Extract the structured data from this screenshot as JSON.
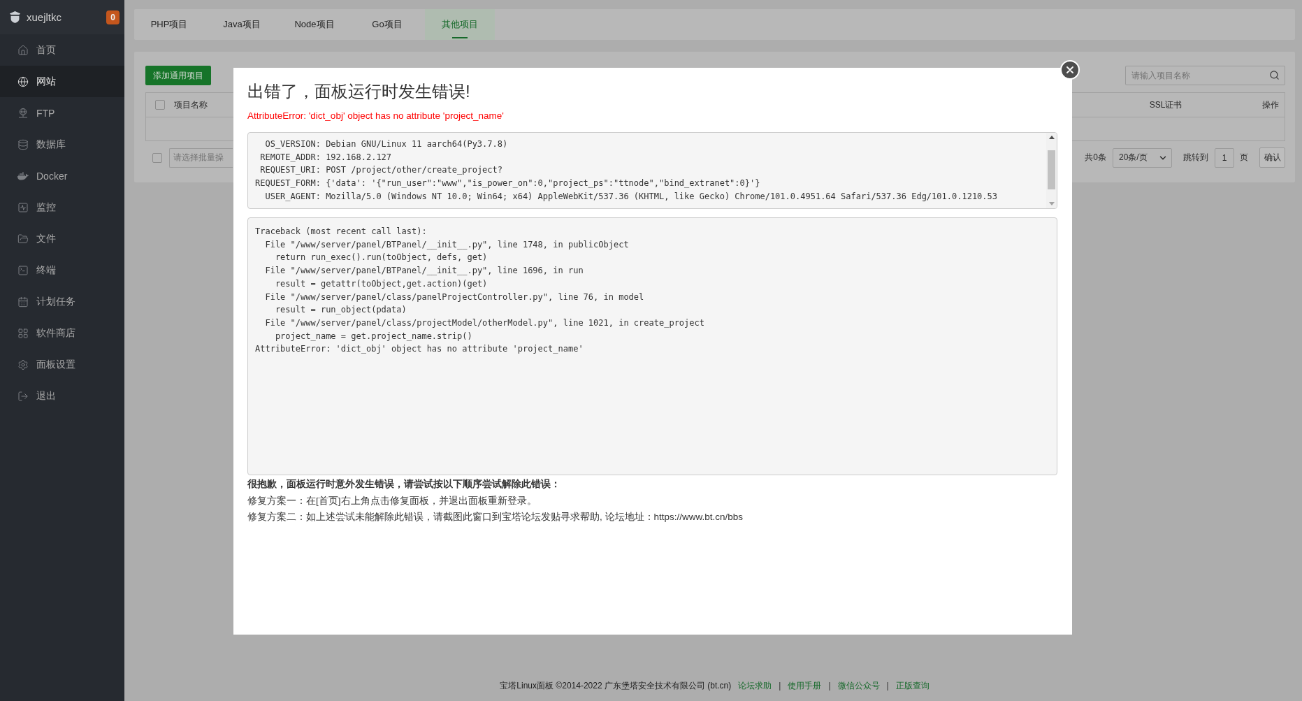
{
  "sidebar": {
    "user": "xuejltkc",
    "badge": "0",
    "items": [
      {
        "label": "首页",
        "selected": false
      },
      {
        "label": "网站",
        "selected": true
      },
      {
        "label": "FTP",
        "selected": false
      },
      {
        "label": "数据库",
        "selected": false
      },
      {
        "label": "Docker",
        "selected": false
      },
      {
        "label": "监控",
        "selected": false
      },
      {
        "label": "文件",
        "selected": false
      },
      {
        "label": "终端",
        "selected": false
      },
      {
        "label": "计划任务",
        "selected": false
      },
      {
        "label": "软件商店",
        "selected": false
      },
      {
        "label": "面板设置",
        "selected": false
      },
      {
        "label": "退出",
        "selected": false
      }
    ]
  },
  "tabs": [
    {
      "label": "PHP项目",
      "selected": false
    },
    {
      "label": "Java项目",
      "selected": false
    },
    {
      "label": "Node项目",
      "selected": false
    },
    {
      "label": "Go项目",
      "selected": false
    },
    {
      "label": "其他项目",
      "selected": true
    }
  ],
  "toolbar": {
    "add_button": "添加通用项目",
    "search": {
      "placeholder": "请输入项目名称"
    }
  },
  "table": {
    "select_all": {
      "checked": false
    },
    "columns": [
      "项目名称",
      "SSL证书",
      "操作"
    ]
  },
  "batch": {
    "checked": false,
    "placeholder": "请选择批量操"
  },
  "pagination": {
    "total": "共0条",
    "page_size": "20条/页",
    "jump_label": "跳转到",
    "page": "1",
    "page_unit": "页",
    "confirm": "确认"
  },
  "dialog": {
    "title": "出错了，面板运行时发生错误!",
    "error": "AttributeError: 'dict_obj' object has no attribute 'project_name'",
    "request_info": [
      "OS_VERSION: Debian GNU/Linux 11 aarch64(Py3.7.8)",
      "REMOTE_ADDR: 192.168.2.127",
      "REQUEST_URI: POST /project/other/create_project?",
      "REQUEST_FORM: {'data': '{\"run_user\":\"www\",\"is_power_on\":0,\"project_ps\":\"ttnode\",\"bind_extranet\":0}'}",
      "USER_AGENT: Mozilla/5.0 (Windows NT 10.0; Win64; x64) AppleWebKit/537.36 (KHTML, like Gecko) Chrome/101.0.4951.64 Safari/537.36 Edg/101.0.1210.53"
    ],
    "traceback": "Traceback (most recent call last):\n  File \"/www/server/panel/BTPanel/__init__.py\", line 1748, in publicObject\n    return run_exec().run(toObject, defs, get)\n  File \"/www/server/panel/BTPanel/__init__.py\", line 1696, in run\n    result = getattr(toObject,get.action)(get)\n  File \"/www/server/panel/class/panelProjectController.py\", line 76, in model\n    result = run_object(pdata)\n  File \"/www/server/panel/class/projectModel/otherModel.py\", line 1021, in create_project\n    project_name = get.project_name.strip()\nAttributeError: 'dict_obj' object has no attribute 'project_name'",
    "help": {
      "heading": "很抱歉，面板运行时意外发生错误，请尝试按以下顺序尝试解除此错误：",
      "steps": [
        "修复方案一：在[首页]右上角点击修复面板，并退出面板重新登录。",
        "修复方案二：如上述尝试未能解除此错误，请截图此窗口到宝塔论坛发贴寻求帮助, 论坛地址：https://www.bt.cn/bbs"
      ]
    }
  },
  "footer": {
    "text": "宝塔Linux面板 ©2014-2022 广东堡塔安全技术有限公司 (bt.cn)",
    "links": [
      "论坛求助",
      "使用手册",
      "微信公众号",
      "正版查询"
    ],
    "separators": [
      "|",
      "|",
      "|"
    ]
  }
}
